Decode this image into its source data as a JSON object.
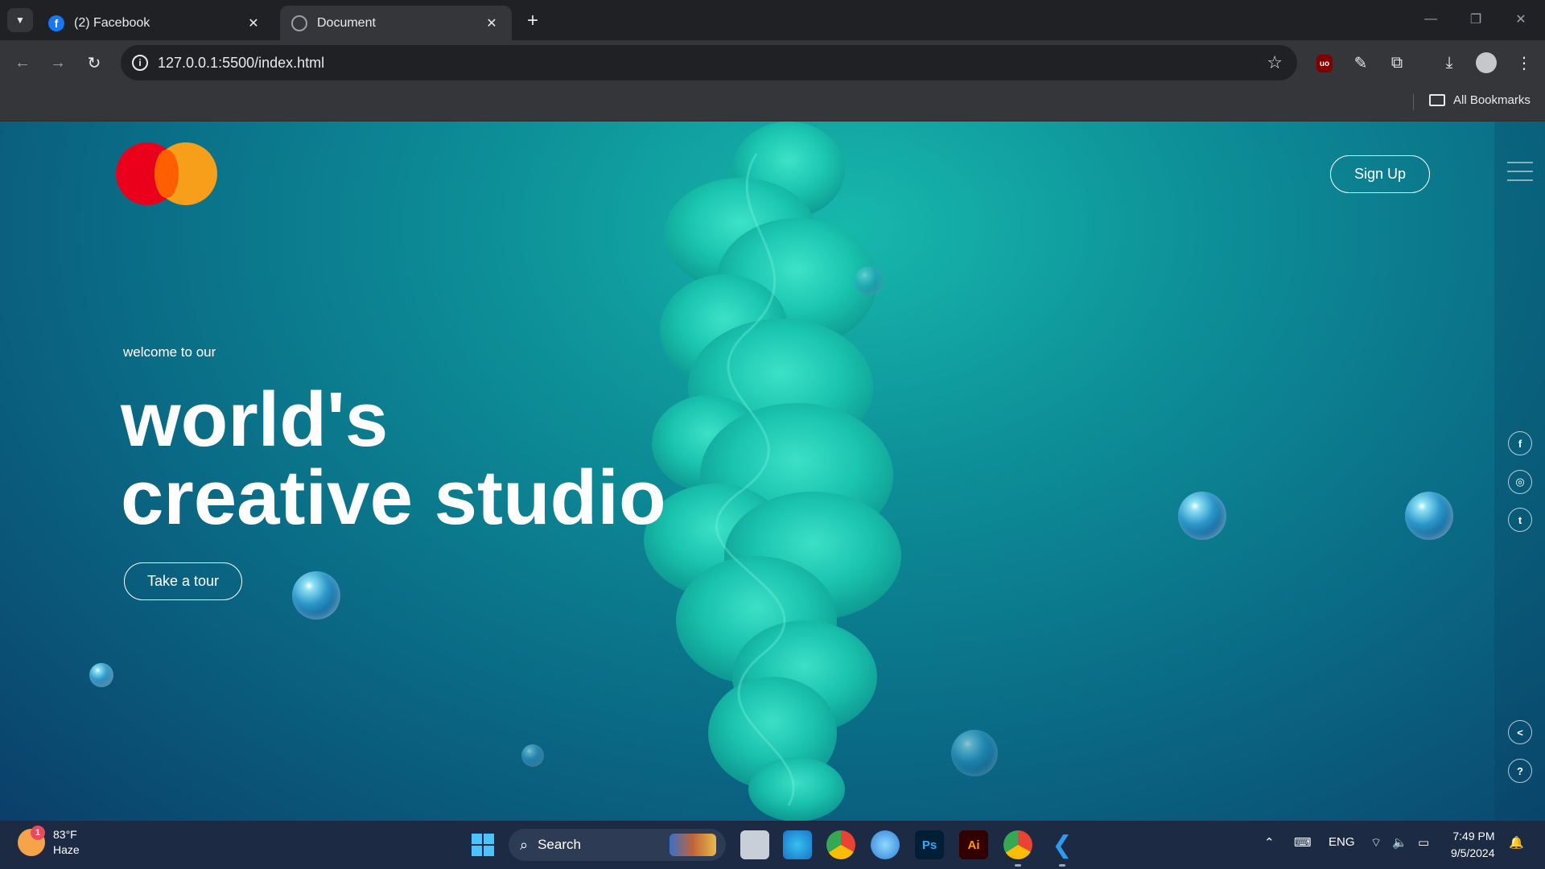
{
  "browser": {
    "tabs": [
      {
        "title": "(2) Facebook",
        "icon": "facebook-icon",
        "active": false
      },
      {
        "title": "Document",
        "icon": "globe-icon",
        "active": true
      }
    ],
    "url": "127.0.0.1:5500/index.html",
    "bookmarks_label": "All Bookmarks"
  },
  "page": {
    "signup_label": "Sign Up",
    "kicker": "welcome to our",
    "title_line1": "world's",
    "title_line2": "creative studio",
    "tour_label": "Take a tour",
    "social": [
      {
        "name": "facebook-icon",
        "glyph": "f"
      },
      {
        "name": "instagram-icon",
        "glyph": "◎"
      },
      {
        "name": "twitter-icon",
        "glyph": "t"
      }
    ],
    "utility": [
      {
        "name": "share-icon",
        "glyph": "<"
      },
      {
        "name": "help-icon",
        "glyph": "?"
      }
    ],
    "colors": {
      "brand_red": "#eb001b",
      "brand_orange": "#f79e1b",
      "water": "#0d8f98"
    }
  },
  "taskbar": {
    "weather_temp": "83°F",
    "weather_desc": "Haze",
    "weather_badge": "1",
    "search_label": "Search",
    "apps": [
      "file-explorer-icon",
      "edge-icon",
      "chrome-icon",
      "photos-icon",
      "photoshop-icon",
      "illustrator-icon",
      "chrome-profile-icon",
      "vscode-icon"
    ],
    "photoshop_label": "Ps",
    "illustrator_label": "Ai",
    "language": "ENG",
    "time": "7:49 PM",
    "date": "9/5/2024"
  }
}
